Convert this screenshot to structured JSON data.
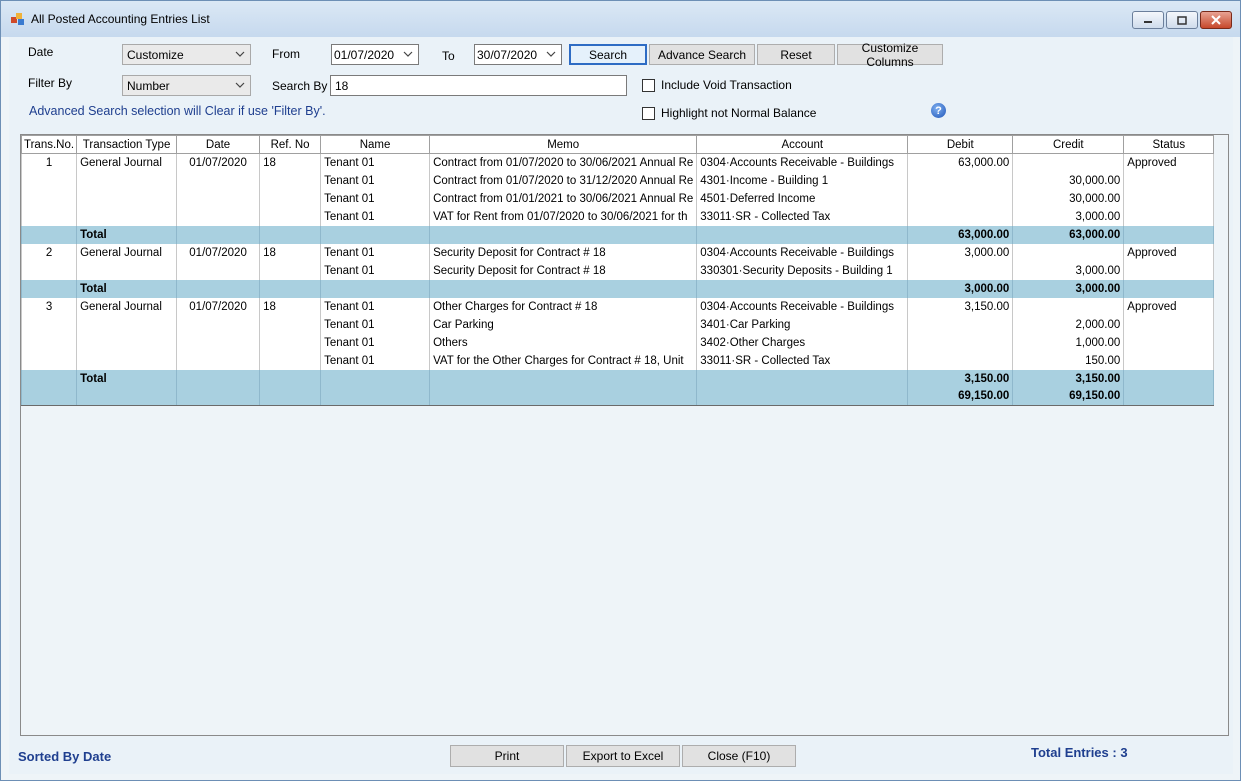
{
  "window": {
    "title": "All Posted Accounting Entries List",
    "icons": {
      "app": "app-icon",
      "minimize": "minimize-icon",
      "maximize": "maximize-icon",
      "close": "close-icon"
    }
  },
  "filters": {
    "date_label": "Date",
    "date_mode": "Customize",
    "from_label": "From",
    "from_value": "01/07/2020",
    "to_label": "To",
    "to_value": "30/07/2020",
    "filter_by_label": "Filter By",
    "filter_by_value": "Number",
    "search_by_label": "Search By",
    "search_by_value": "18",
    "include_void_label": "Include Void Transaction",
    "highlight_label": "Highlight not Normal Balance",
    "hint": "Advanced Search selection will Clear if use 'Filter By'."
  },
  "toolbar": {
    "search": "Search",
    "advance_search": "Advance Search",
    "reset": "Reset",
    "customize_columns": "Customize Columns"
  },
  "grid": {
    "columns": [
      "Trans.No.",
      "Transaction Type",
      "Date",
      "Ref. No",
      "Name",
      "Memo",
      "Account",
      "Debit",
      "Credit",
      "Status"
    ],
    "rows": [
      {
        "kind": "row",
        "cells": [
          "1",
          "General Journal",
          "01/07/2020",
          "18",
          "Tenant 01",
          "Contract from 01/07/2020 to 30/06/2021 Annual Re",
          "0304·Accounts Receivable - Buildings",
          "63,000.00",
          "",
          "Approved"
        ]
      },
      {
        "kind": "row",
        "cells": [
          "",
          "",
          "",
          "",
          "Tenant 01",
          "Contract from 01/07/2020 to 31/12/2020 Annual Re",
          "4301·Income - Building 1",
          "",
          "30,000.00",
          ""
        ]
      },
      {
        "kind": "row",
        "cells": [
          "",
          "",
          "",
          "",
          "Tenant 01",
          "Contract from 01/01/2021 to 30/06/2021 Annual Re",
          "4501·Deferred Income",
          "",
          "30,000.00",
          ""
        ]
      },
      {
        "kind": "row",
        "cells": [
          "",
          "",
          "",
          "",
          "Tenant 01",
          "VAT for Rent from 01/07/2020 to 30/06/2021 for th",
          "33011·SR - Collected Tax",
          "",
          "3,000.00",
          ""
        ]
      },
      {
        "kind": "total",
        "cells": [
          "",
          "Total",
          "",
          "",
          "",
          "",
          "",
          "63,000.00",
          "63,000.00",
          ""
        ]
      },
      {
        "kind": "row",
        "cells": [
          "2",
          "General Journal",
          "01/07/2020",
          "18",
          "Tenant 01",
          "Security Deposit for Contract # 18",
          "0304·Accounts Receivable - Buildings",
          "3,000.00",
          "",
          "Approved"
        ]
      },
      {
        "kind": "row",
        "cells": [
          "",
          "",
          "",
          "",
          "Tenant 01",
          "Security Deposit for Contract # 18",
          "330301·Security Deposits - Building 1",
          "",
          "3,000.00",
          ""
        ]
      },
      {
        "kind": "total",
        "cells": [
          "",
          "Total",
          "",
          "",
          "",
          "",
          "",
          "3,000.00",
          "3,000.00",
          ""
        ]
      },
      {
        "kind": "row",
        "cells": [
          "3",
          "General Journal",
          "01/07/2020",
          "18",
          "Tenant 01",
          "Other Charges for Contract # 18",
          "0304·Accounts Receivable - Buildings",
          "3,150.00",
          "",
          "Approved"
        ]
      },
      {
        "kind": "row",
        "cells": [
          "",
          "",
          "",
          "",
          "Tenant 01",
          "Car Parking",
          "3401·Car Parking",
          "",
          "2,000.00",
          ""
        ]
      },
      {
        "kind": "row",
        "cells": [
          "",
          "",
          "",
          "",
          "Tenant 01",
          "Others",
          "3402·Other Charges",
          "",
          "1,000.00",
          ""
        ]
      },
      {
        "kind": "row",
        "cells": [
          "",
          "",
          "",
          "",
          "Tenant 01",
          "VAT for the Other Charges for Contract # 18, Unit",
          "33011·SR - Collected Tax",
          "",
          "150.00",
          ""
        ]
      },
      {
        "kind": "total",
        "cells": [
          "",
          "Total",
          "",
          "",
          "",
          "",
          "",
          "3,150.00",
          "3,150.00",
          ""
        ]
      },
      {
        "kind": "grand",
        "cells": [
          "",
          "",
          "",
          "",
          "",
          "",
          "",
          "69,150.00",
          "69,150.00",
          ""
        ]
      }
    ]
  },
  "footer": {
    "sorted_by": "Sorted By Date",
    "print": "Print",
    "export": "Export to Excel",
    "close": "Close (F10)",
    "total_entries": "Total Entries : 3"
  }
}
